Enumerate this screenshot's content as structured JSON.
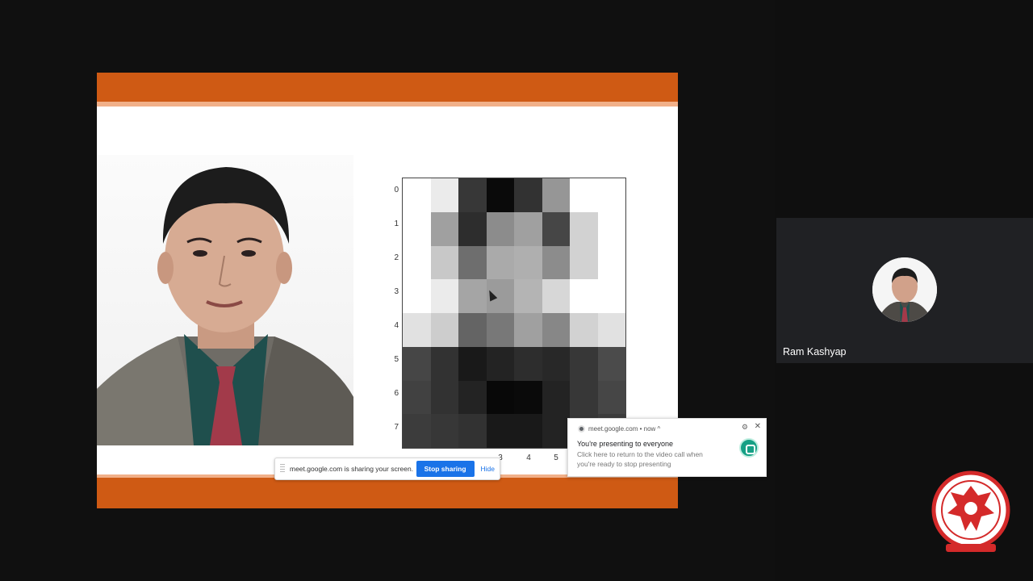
{
  "slide": {
    "heatmap": {
      "y_ticks": [
        "0",
        "1",
        "2",
        "3",
        "4",
        "5",
        "6",
        "7"
      ],
      "x_ticks": [
        "",
        "",
        "",
        "3",
        "4",
        "5",
        "",
        ""
      ],
      "grayscale_levels": [
        [
          255,
          235,
          55,
          10,
          50,
          150,
          255,
          255
        ],
        [
          255,
          160,
          45,
          140,
          160,
          70,
          210,
          255
        ],
        [
          255,
          200,
          110,
          170,
          175,
          140,
          210,
          255
        ],
        [
          255,
          235,
          165,
          155,
          180,
          215,
          255,
          255
        ],
        [
          225,
          205,
          100,
          120,
          160,
          135,
          210,
          225
        ],
        [
          70,
          50,
          25,
          35,
          45,
          40,
          55,
          75
        ],
        [
          65,
          50,
          35,
          8,
          10,
          35,
          55,
          70
        ],
        [
          60,
          55,
          50,
          25,
          25,
          35,
          55,
          60
        ]
      ]
    }
  },
  "share_bar": {
    "message": "meet.google.com is sharing your screen.",
    "stop_label": "Stop sharing",
    "hide_label": "Hide"
  },
  "notification": {
    "source": "meet.google.com • now ^",
    "title": "You're presenting to everyone",
    "body": "Click here to return to the video call when you're ready to stop presenting"
  },
  "participant": {
    "name": "Ram Kashyap"
  },
  "colors": {
    "slide_band": "#cf5a14",
    "stop_button": "#1a73e8",
    "meet_green": "#16a085"
  }
}
